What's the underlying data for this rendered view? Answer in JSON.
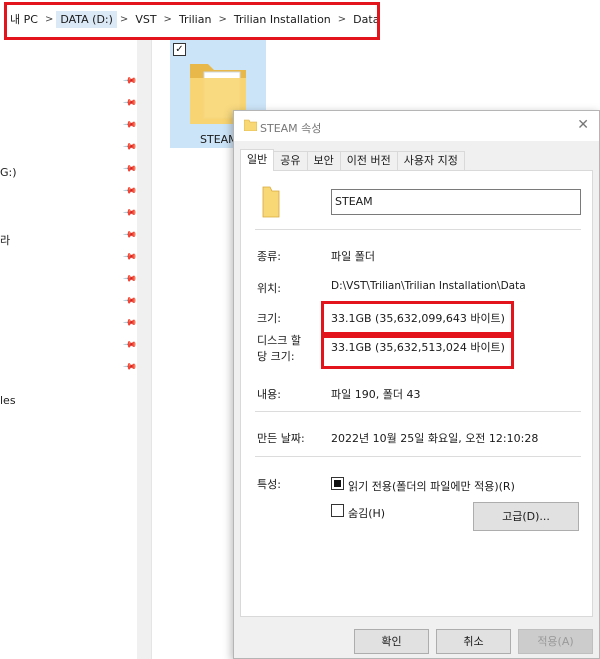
{
  "breadcrumb": [
    "내 PC",
    "DATA (D:)",
    "VST",
    "Trilian",
    "Trilian Installation",
    "Data"
  ],
  "nav_fragments": [
    "G:)",
    "라",
    "les"
  ],
  "folder_tile": {
    "label": "STEAM"
  },
  "dialog": {
    "title": "STEAM 속성",
    "tabs": [
      "일반",
      "공유",
      "보안",
      "이전 버전",
      "사용자 지정"
    ],
    "name": "STEAM",
    "labels": {
      "type": "종류:",
      "location": "위치:",
      "size": "크기:",
      "disk_size_line1": "디스크 할",
      "disk_size_line2": "당 크기:",
      "contains": "내용:",
      "created": "만든 날짜:",
      "attributes": "특성:"
    },
    "values": {
      "type": "파일 폴더",
      "location": "D:\\VST\\Trilian\\Trilian Installation\\Data",
      "size": "33.1GB (35,632,099,643 바이트)",
      "disk_size": "33.1GB (35,632,513,024 바이트)",
      "contains": "파일 190, 폴더 43",
      "created": "2022년 10월 25일 화요일, 오전 12:10:28"
    },
    "attributes": {
      "readonly": "읽기 전용(폴더의 파일에만 적용)(R)",
      "hidden": "숨김(H)",
      "advanced": "고급(D)..."
    },
    "buttons": {
      "ok": "확인",
      "cancel": "취소",
      "apply": "적용(A)"
    }
  },
  "colors": {
    "highlight_red": "#e3141c",
    "selection_blue": "#cce4f7",
    "folder_yellow": "#f8d775"
  }
}
